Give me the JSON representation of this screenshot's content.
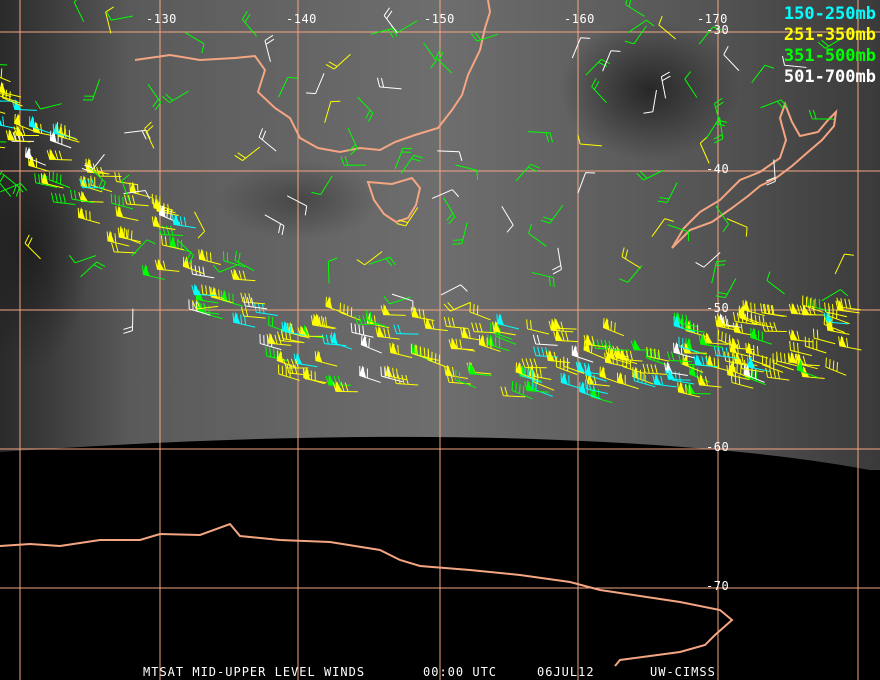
{
  "title": "MTSAT MID-UPPER LEVEL WINDS",
  "time": "00:00 UTC",
  "date": "06JUL12",
  "source": "UW-CIMSS",
  "longitude_labels": [
    "-130",
    "-140",
    "-150",
    "-160",
    "-170"
  ],
  "latitude_labels": [
    "-30",
    "-40",
    "-50",
    "-60",
    "-70"
  ],
  "legend": [
    {
      "label": "150-250mb",
      "color": "#00ffff"
    },
    {
      "label": "251-350mb",
      "color": "#ffff00"
    },
    {
      "label": "351-500mb",
      "color": "#00ff00"
    },
    {
      "label": "501-700mb",
      "color": "#ffffff"
    }
  ],
  "colors": {
    "grid": "#f4a582",
    "coast": "#f4a582",
    "background": "#000000"
  }
}
